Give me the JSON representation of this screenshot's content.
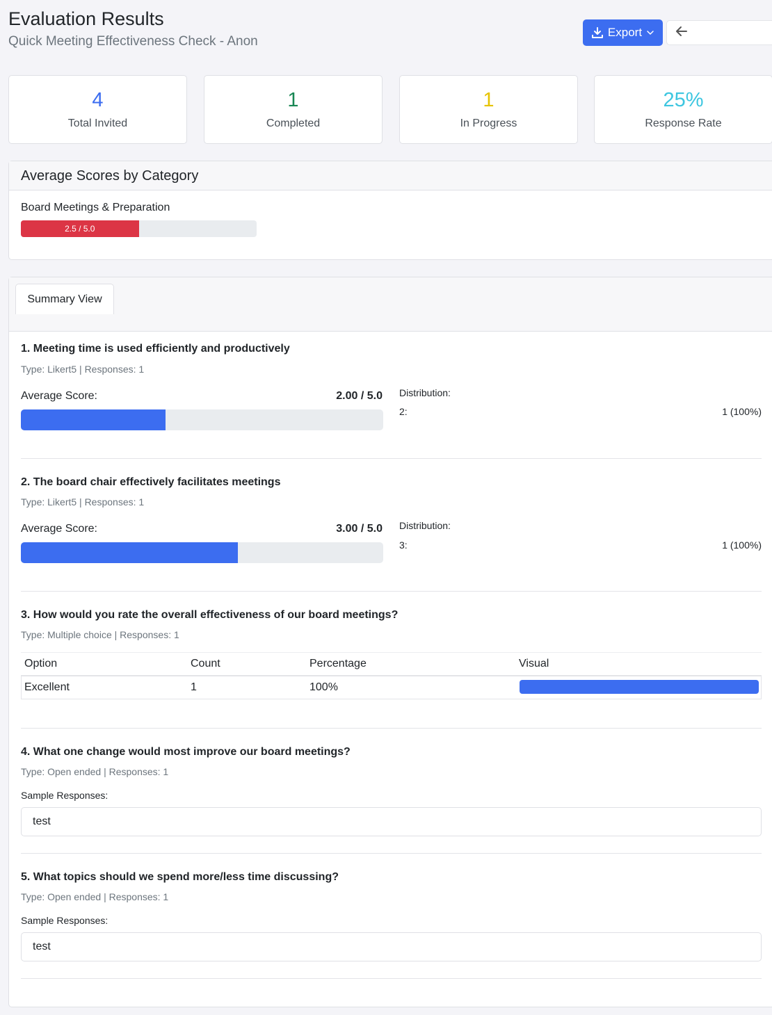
{
  "header": {
    "title": "Evaluation Results",
    "subtitle": "Quick Meeting Effectiveness Check - Anon",
    "export_label": "Export"
  },
  "stats": [
    {
      "value": "4",
      "label": "Total Invited",
      "color": "#3c6df0"
    },
    {
      "value": "1",
      "label": "Completed",
      "color": "#198754"
    },
    {
      "value": "1",
      "label": "In Progress",
      "color": "#e6c300"
    },
    {
      "value": "25%",
      "label": "Response Rate",
      "color": "#3dc6e0"
    }
  ],
  "categories": {
    "heading": "Average Scores by Category",
    "items": [
      {
        "name": "Board Meetings & Preparation",
        "score_text": "2.5 / 5.0",
        "score": 2.5,
        "max": 5.0,
        "color": "#dc3545"
      }
    ]
  },
  "summary": {
    "tab_label": "Summary View",
    "questions": [
      {
        "title": "1. Meeting time is used efficiently and productively",
        "meta": "Type: Likert5 | Responses: 1",
        "avg_label": "Average Score:",
        "avg_value": "2.00 / 5.0",
        "avg": 2.0,
        "dist_label": "Distribution:",
        "dist_key": "2:",
        "dist_val": "1 (100%)"
      },
      {
        "title": "2. The board chair effectively facilitates meetings",
        "meta": "Type: Likert5 | Responses: 1",
        "avg_label": "Average Score:",
        "avg_value": "3.00 / 5.0",
        "avg": 3.0,
        "dist_label": "Distribution:",
        "dist_key": "3:",
        "dist_val": "1 (100%)"
      },
      {
        "title": "3. How would you rate the overall effectiveness of our board meetings?",
        "meta": "Type: Multiple choice | Responses: 1",
        "table": {
          "headers": [
            "Option",
            "Count",
            "Percentage",
            "Visual"
          ],
          "rows": [
            [
              "Excellent",
              "1",
              "100%"
            ]
          ],
          "visual_fraction": 1.0
        }
      },
      {
        "title": "4. What one change would most improve our board meetings?",
        "meta": "Type: Open ended | Responses: 1",
        "sample_label": "Sample Responses:",
        "response": "test"
      },
      {
        "title": "5. What topics should we spend more/less time discussing?",
        "meta": "Type: Open ended | Responses: 1",
        "sample_label": "Sample Responses:",
        "response": "test"
      }
    ]
  }
}
